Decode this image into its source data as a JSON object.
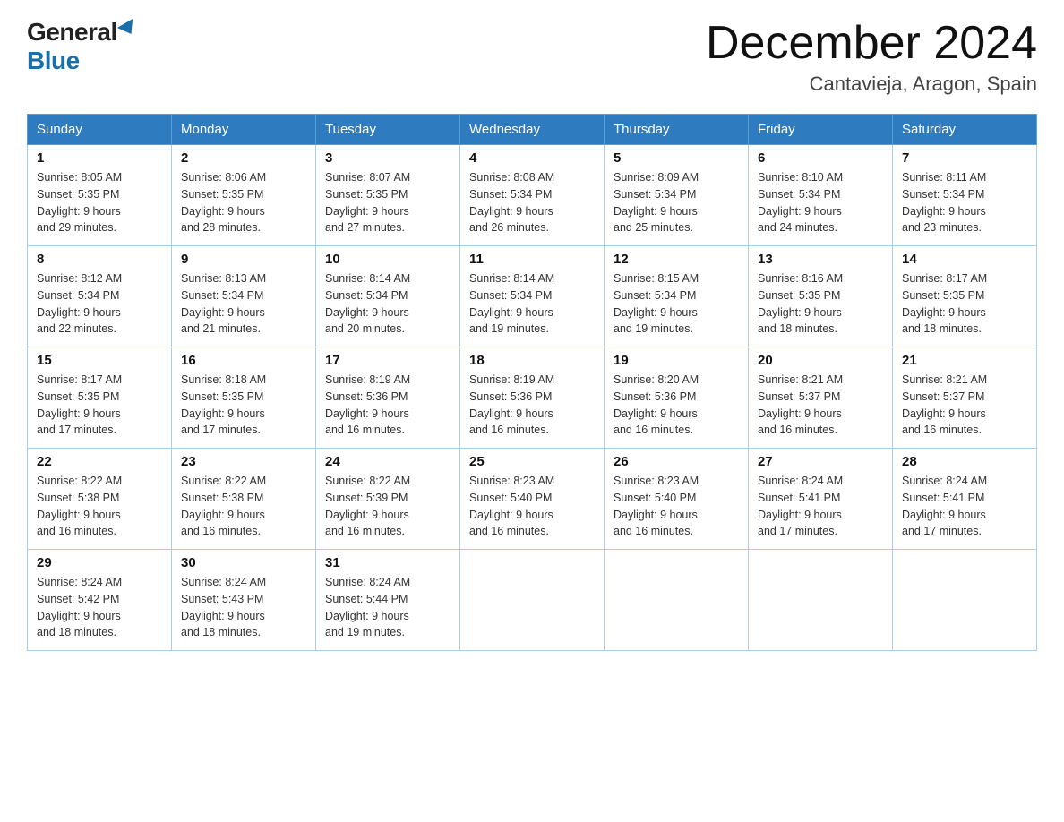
{
  "header": {
    "logo_general": "General",
    "logo_blue": "Blue",
    "title": "December 2024",
    "location": "Cantavieja, Aragon, Spain"
  },
  "weekdays": [
    "Sunday",
    "Monday",
    "Tuesday",
    "Wednesday",
    "Thursday",
    "Friday",
    "Saturday"
  ],
  "weeks": [
    [
      {
        "day": "1",
        "sunrise": "8:05 AM",
        "sunset": "5:35 PM",
        "daylight": "9 hours and 29 minutes."
      },
      {
        "day": "2",
        "sunrise": "8:06 AM",
        "sunset": "5:35 PM",
        "daylight": "9 hours and 28 minutes."
      },
      {
        "day": "3",
        "sunrise": "8:07 AM",
        "sunset": "5:35 PM",
        "daylight": "9 hours and 27 minutes."
      },
      {
        "day": "4",
        "sunrise": "8:08 AM",
        "sunset": "5:34 PM",
        "daylight": "9 hours and 26 minutes."
      },
      {
        "day": "5",
        "sunrise": "8:09 AM",
        "sunset": "5:34 PM",
        "daylight": "9 hours and 25 minutes."
      },
      {
        "day": "6",
        "sunrise": "8:10 AM",
        "sunset": "5:34 PM",
        "daylight": "9 hours and 24 minutes."
      },
      {
        "day": "7",
        "sunrise": "8:11 AM",
        "sunset": "5:34 PM",
        "daylight": "9 hours and 23 minutes."
      }
    ],
    [
      {
        "day": "8",
        "sunrise": "8:12 AM",
        "sunset": "5:34 PM",
        "daylight": "9 hours and 22 minutes."
      },
      {
        "day": "9",
        "sunrise": "8:13 AM",
        "sunset": "5:34 PM",
        "daylight": "9 hours and 21 minutes."
      },
      {
        "day": "10",
        "sunrise": "8:14 AM",
        "sunset": "5:34 PM",
        "daylight": "9 hours and 20 minutes."
      },
      {
        "day": "11",
        "sunrise": "8:14 AM",
        "sunset": "5:34 PM",
        "daylight": "9 hours and 19 minutes."
      },
      {
        "day": "12",
        "sunrise": "8:15 AM",
        "sunset": "5:34 PM",
        "daylight": "9 hours and 19 minutes."
      },
      {
        "day": "13",
        "sunrise": "8:16 AM",
        "sunset": "5:35 PM",
        "daylight": "9 hours and 18 minutes."
      },
      {
        "day": "14",
        "sunrise": "8:17 AM",
        "sunset": "5:35 PM",
        "daylight": "9 hours and 18 minutes."
      }
    ],
    [
      {
        "day": "15",
        "sunrise": "8:17 AM",
        "sunset": "5:35 PM",
        "daylight": "9 hours and 17 minutes."
      },
      {
        "day": "16",
        "sunrise": "8:18 AM",
        "sunset": "5:35 PM",
        "daylight": "9 hours and 17 minutes."
      },
      {
        "day": "17",
        "sunrise": "8:19 AM",
        "sunset": "5:36 PM",
        "daylight": "9 hours and 16 minutes."
      },
      {
        "day": "18",
        "sunrise": "8:19 AM",
        "sunset": "5:36 PM",
        "daylight": "9 hours and 16 minutes."
      },
      {
        "day": "19",
        "sunrise": "8:20 AM",
        "sunset": "5:36 PM",
        "daylight": "9 hours and 16 minutes."
      },
      {
        "day": "20",
        "sunrise": "8:21 AM",
        "sunset": "5:37 PM",
        "daylight": "9 hours and 16 minutes."
      },
      {
        "day": "21",
        "sunrise": "8:21 AM",
        "sunset": "5:37 PM",
        "daylight": "9 hours and 16 minutes."
      }
    ],
    [
      {
        "day": "22",
        "sunrise": "8:22 AM",
        "sunset": "5:38 PM",
        "daylight": "9 hours and 16 minutes."
      },
      {
        "day": "23",
        "sunrise": "8:22 AM",
        "sunset": "5:38 PM",
        "daylight": "9 hours and 16 minutes."
      },
      {
        "day": "24",
        "sunrise": "8:22 AM",
        "sunset": "5:39 PM",
        "daylight": "9 hours and 16 minutes."
      },
      {
        "day": "25",
        "sunrise": "8:23 AM",
        "sunset": "5:40 PM",
        "daylight": "9 hours and 16 minutes."
      },
      {
        "day": "26",
        "sunrise": "8:23 AM",
        "sunset": "5:40 PM",
        "daylight": "9 hours and 16 minutes."
      },
      {
        "day": "27",
        "sunrise": "8:24 AM",
        "sunset": "5:41 PM",
        "daylight": "9 hours and 17 minutes."
      },
      {
        "day": "28",
        "sunrise": "8:24 AM",
        "sunset": "5:41 PM",
        "daylight": "9 hours and 17 minutes."
      }
    ],
    [
      {
        "day": "29",
        "sunrise": "8:24 AM",
        "sunset": "5:42 PM",
        "daylight": "9 hours and 18 minutes."
      },
      {
        "day": "30",
        "sunrise": "8:24 AM",
        "sunset": "5:43 PM",
        "daylight": "9 hours and 18 minutes."
      },
      {
        "day": "31",
        "sunrise": "8:24 AM",
        "sunset": "5:44 PM",
        "daylight": "9 hours and 19 minutes."
      },
      null,
      null,
      null,
      null
    ]
  ]
}
